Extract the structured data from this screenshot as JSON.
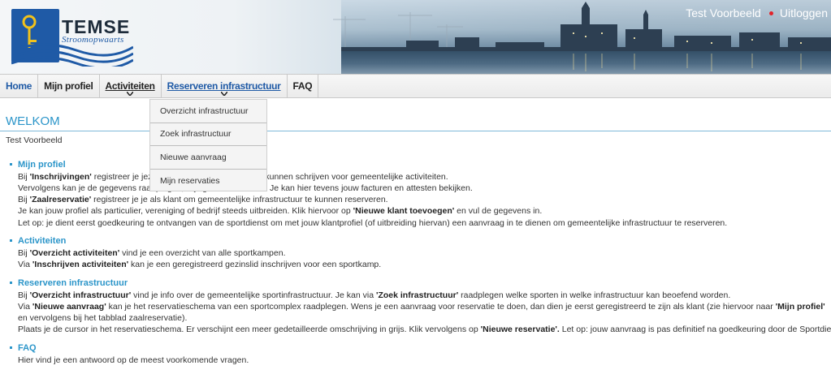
{
  "header": {
    "logo_title": "TEMSE",
    "logo_subtitle": "Stroomopwaarts",
    "user_name": "Test Voorbeeld",
    "logout_label": "Uitloggen"
  },
  "nav": {
    "items": [
      {
        "label": "Home"
      },
      {
        "label": "Mijn profiel"
      },
      {
        "label": "Activiteiten"
      },
      {
        "label": "Reserveren infrastructuur"
      },
      {
        "label": "FAQ"
      }
    ]
  },
  "dropdown": {
    "items": [
      {
        "label": "Overzicht infrastructuur"
      },
      {
        "label": "Zoek infrastructuur"
      },
      {
        "label": "Nieuwe aanvraag"
      },
      {
        "label": "Mijn reservaties"
      }
    ]
  },
  "main": {
    "title": "WELKOM",
    "user_line": "Test Voorbeeld",
    "sections": [
      {
        "title": "Mijn profiel",
        "lines": [
          [
            "Bij ",
            "'Inschrijvingen'",
            " registreer je jezelf en je gezinsleden om in te kunnen schrijven voor gemeentelijke activiteiten."
          ],
          [
            "Vervolgens kan je de gegevens raadplegen, wijzigen of aanvullen. Je kan hier tevens jouw facturen en attesten bekijken."
          ],
          [
            "Bij ",
            "'Zaalreservatie'",
            " registreer je je als klant om gemeentelijke infrastructuur te kunnen reserveren."
          ],
          [
            "Je kan jouw profiel als particulier, vereniging of bedrijf steeds uitbreiden. Klik hiervoor op ",
            "'Nieuwe klant toevoegen'",
            " en vul de gegevens in."
          ],
          [
            "Let op: je dient eerst goedkeuring te ontvangen van de sportdienst om met jouw klantprofiel (of uitbreiding hiervan) een aanvraag in te dienen om gemeentelijke infrastructuur te reserveren."
          ]
        ]
      },
      {
        "title": "Activiteiten",
        "lines": [
          [
            "Bij ",
            "'Overzicht activiteiten'",
            " vind je een overzicht van alle sportkampen."
          ],
          [
            "Via ",
            "'Inschrijven activiteiten'",
            " kan je een geregistreerd gezinslid inschrijven voor een sportkamp."
          ]
        ]
      },
      {
        "title": "Reserveren infrastructuur",
        "lines": [
          [
            "Bij ",
            "'Overzicht infrastructuur'",
            " vind je info over de gemeentelijke sportinfrastructuur. Je kan via ",
            "'Zoek infrastructuur'",
            " raadplegen welke sporten in welke infrastructuur kan beoefend worden."
          ],
          [
            "Via ",
            "'Nieuwe aanvraag'",
            " kan je het reservatieschema van een sportcomplex raadplegen. Wens je een aanvraag voor reservatie te doen, dan dien je eerst geregistreerd te zijn als klant (zie hiervoor naar ",
            "'Mijn profiel'",
            " en vervolgens bij het tabblad zaalreservatie)."
          ],
          [
            "Plaats je de cursor in het reservatieschema. Er verschijnt een meer gedetailleerde omschrijving in grijs. Klik vervolgens op ",
            "'Nieuwe reservatie'.",
            " Let op: jouw aanvraag is pas definitief na goedkeuring door de Sportdienst."
          ]
        ]
      },
      {
        "title": "FAQ",
        "lines": [
          [
            "Hier vind je een antwoord op de meest voorkomende vragen."
          ]
        ]
      }
    ]
  },
  "colors": {
    "accent": "#2b95c9",
    "brand_blue": "#1f5aa6",
    "logout_dot": "#e2232a"
  },
  "icons": {
    "logo": "temse-key-shield-icon",
    "nav_dropdown": "chevron-down-icon",
    "bullet": "square-bullet-icon"
  }
}
